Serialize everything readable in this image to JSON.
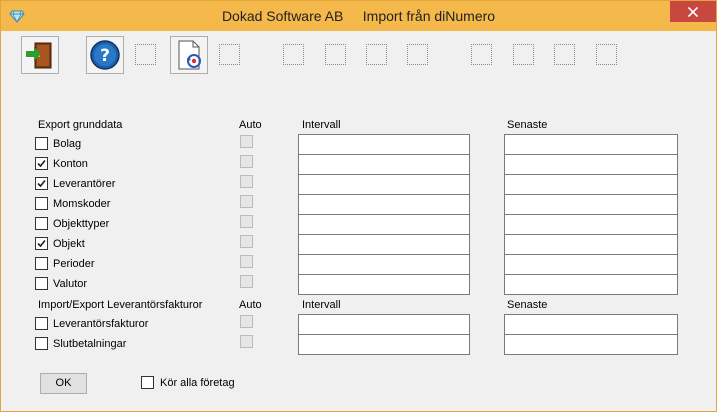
{
  "window": {
    "title": "Dokad Software AB     Import från diNumero"
  },
  "toolbar": {
    "icons": [
      "exit-door-icon",
      "help-icon",
      "placeholder",
      "document-refresh-icon",
      "placeholder",
      "placeholder",
      "placeholder",
      "placeholder",
      "placeholder",
      "placeholder",
      "placeholder",
      "placeholder"
    ]
  },
  "export_section": {
    "heading": "Export grunddata",
    "auto_label": "Auto",
    "interval_label": "Intervall",
    "latest_label": "Senaste",
    "items": [
      {
        "label": "Bolag",
        "checked": false,
        "interval": "",
        "latest": ""
      },
      {
        "label": "Konton",
        "checked": true,
        "interval": "",
        "latest": ""
      },
      {
        "label": "Leverantörer",
        "checked": true,
        "interval": "",
        "latest": ""
      },
      {
        "label": "Momskoder",
        "checked": false,
        "interval": "",
        "latest": ""
      },
      {
        "label": "Objekttyper",
        "checked": false,
        "interval": "",
        "latest": ""
      },
      {
        "label": "Objekt",
        "checked": true,
        "interval": "",
        "latest": ""
      },
      {
        "label": "Perioder",
        "checked": false,
        "interval": "",
        "latest": ""
      },
      {
        "label": "Valutor",
        "checked": false,
        "interval": "",
        "latest": ""
      }
    ]
  },
  "invoice_section": {
    "heading": "Import/Export Leverantörsfakturor",
    "auto_label": "Auto",
    "interval_label": "Intervall",
    "latest_label": "Senaste",
    "items": [
      {
        "label": "Leverantörsfakturor",
        "checked": false,
        "interval": "",
        "latest": ""
      },
      {
        "label": "Slutbetalningar",
        "checked": false,
        "interval": "",
        "latest": ""
      }
    ]
  },
  "footer": {
    "ok_label": "OK",
    "run_all_label": "Kör alla företag",
    "run_all_checked": false
  }
}
